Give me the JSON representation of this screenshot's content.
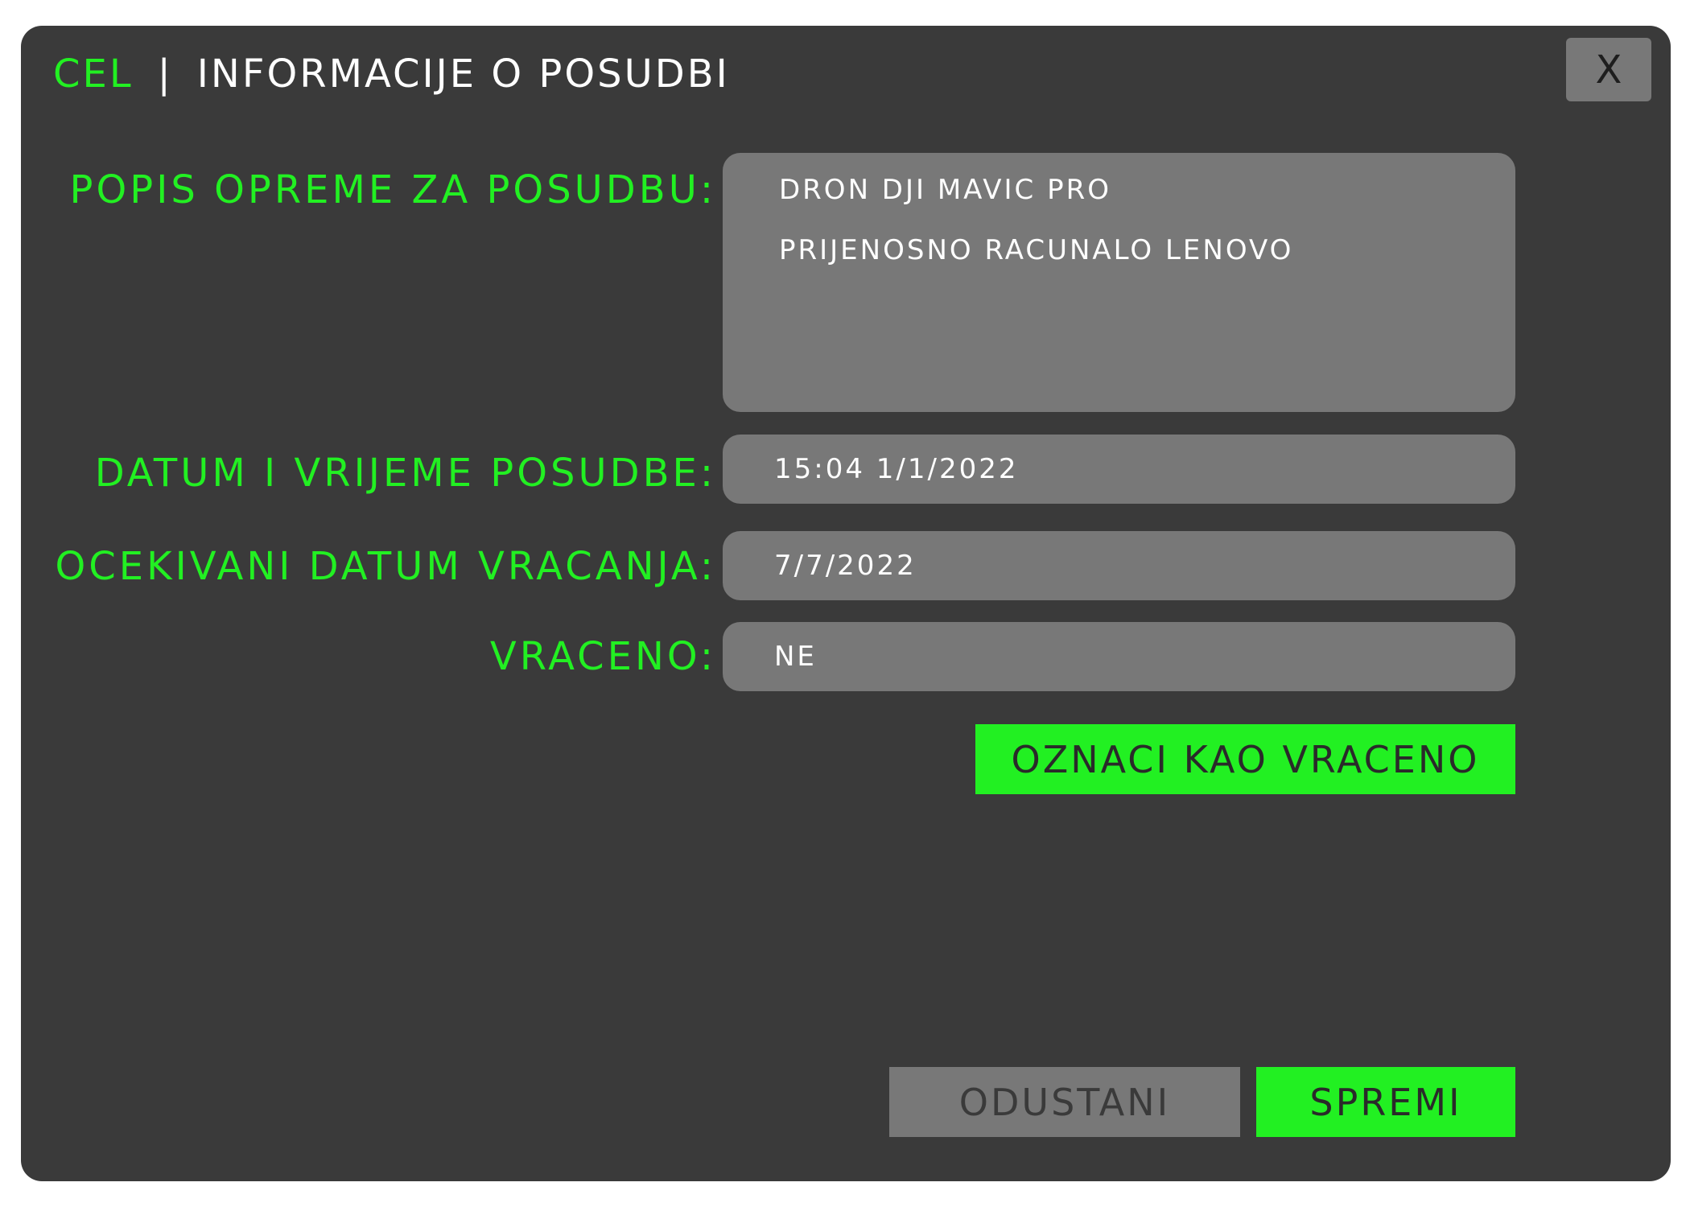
{
  "header": {
    "brand": "CEL",
    "separator": "|",
    "title": "INFORMACIJE O POSUDBI",
    "close_label": "X"
  },
  "form": {
    "equipment": {
      "label": "POPIS OPREME ZA POSUDBU:",
      "items": [
        "DRON DJI MAVIC PRO",
        "PRIJENOSNO RACUNALO LENOVO"
      ]
    },
    "loan_datetime": {
      "label": "DATUM I VRIJEME POSUDBE:",
      "value": "15:04 1/1/2022"
    },
    "expected_return": {
      "label": "OCEKIVANI DATUM VRACANJA:",
      "value": "7/7/2022"
    },
    "returned": {
      "label": "VRACENO:",
      "value": "NE"
    },
    "mark_returned_label": "OZNACI KAO VRACENO"
  },
  "footer": {
    "cancel_label": "ODUSTANI",
    "save_label": "SPREMI"
  },
  "colors": {
    "accent": "#22f022",
    "background": "#3a3a3a",
    "field": "#787878"
  }
}
